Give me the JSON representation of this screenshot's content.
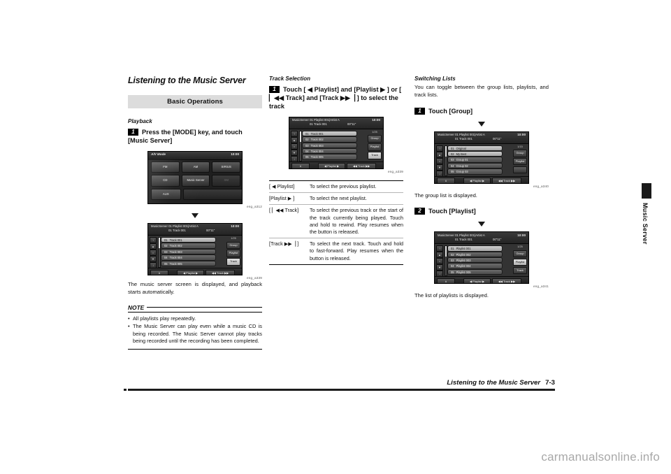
{
  "document": {
    "chapter_title": "Listening to the Music Server",
    "section_bar": "Basic Operations",
    "footer_title": "Listening to the Music Server",
    "footer_page": "7-3",
    "side_tab_label": "Music Server",
    "watermark": "carmanualsonline.info"
  },
  "left_column": {
    "sub_head": "Playback",
    "step1": {
      "number": "1",
      "text": "Press the [MODE] key, and touch [Music Server]"
    },
    "figure_av_mode": {
      "caption": "eng_a312",
      "title": "A/V Mode",
      "clock": "10:00",
      "buttons": [
        "FM",
        "AM",
        "SIRIUS",
        "CD",
        "Music Server",
        "XM",
        "AUX"
      ]
    },
    "figure_music_server": {
      "caption": "eng_a339",
      "header_line1": "MusicServer   01 Playlist 001|Artist A",
      "header_line2": "01 Track 001",
      "time": "00\"11\"",
      "clock": "10:00",
      "count": "1/25",
      "rail_buttons": [
        "↑",
        "▲",
        "○",
        "▼",
        "↓"
      ],
      "rows": [
        {
          "index": "01",
          "label": "Track 001",
          "selected": true
        },
        {
          "index": "02",
          "label": "Track 002",
          "selected": false
        },
        {
          "index": "03",
          "label": "Track 003",
          "selected": false
        },
        {
          "index": "04",
          "label": "Track 004",
          "selected": false
        },
        {
          "index": "05",
          "label": "Track 005",
          "selected": false
        }
      ],
      "right_buttons": [
        {
          "label": "Group",
          "active": false
        },
        {
          "label": "Playlist",
          "active": false
        },
        {
          "label": "Track",
          "active": true
        }
      ],
      "foot_buttons": [
        "∧",
        "◀ Playlist ▶",
        "◀◀ Track ▶▶"
      ]
    },
    "body_text": "The music server screen is displayed, and playback starts automatically.",
    "note": {
      "title": "NOTE",
      "items": [
        "All playlists play repeatedly.",
        "The Music Server can play even while a music CD is being recorded. The Music Server cannot play tracks being recorded until the recording has been completed."
      ]
    }
  },
  "middle_column": {
    "sub_head": "Track Selection",
    "step1": {
      "number": "1",
      "text_part1": "Touch [ ",
      "glyph1": "◀",
      "text_part2": " Playlist] and [Playlist ",
      "glyph2": "▶",
      "text_part3": " ] or [ ",
      "glyph3": "▏◀◀",
      "text_part4": " Track] and [Track ",
      "glyph4": "▶▶▕",
      "text_part5": " ] to select the track",
      "full_text": "Touch [ ◀ Playlist] and [Playlist ▶ ] or [ ▏◀◀ Track] and [Track ▶▶▕ ] to select the track"
    },
    "figure_music_server": {
      "caption": "eng_a339",
      "header_line1": "MusicServer   01 Playlist 001|Artist A",
      "header_line2": "01 Track 001",
      "time": "00\"11\"",
      "clock": "10:00",
      "count": "1/25",
      "rail_buttons": [
        "↑",
        "▲",
        "○",
        "▼",
        "↓"
      ],
      "rows": [
        {
          "index": "01",
          "label": "Track 001",
          "selected": true
        },
        {
          "index": "02",
          "label": "Track 002",
          "selected": false
        },
        {
          "index": "03",
          "label": "Track 003",
          "selected": false
        },
        {
          "index": "04",
          "label": "Track 004",
          "selected": false
        },
        {
          "index": "05",
          "label": "Track 005",
          "selected": false
        }
      ],
      "right_buttons": [
        {
          "label": "Group",
          "active": false
        },
        {
          "label": "Playlist",
          "active": false
        },
        {
          "label": "Track",
          "active": true
        }
      ],
      "foot_buttons": [
        "∧",
        "◀ Playlist ▶",
        "◀◀ Track ▶▶"
      ]
    },
    "spec_table": [
      {
        "key": "[ ◀ Playlist]",
        "desc": "To select the previous playlist."
      },
      {
        "key": "[Playlist ▶ ]",
        "desc": "To select the next playlist."
      },
      {
        "key": "[ ▏◀◀ Track]",
        "desc": "To select the previous track or the start of the track currently being played. Touch and hold to rewind. Play resumes when the button is released."
      },
      {
        "key": "[Track ▶▶▕ ]",
        "desc": "To select the next track. Touch and hold to fast-forward. Play resumes when the button is released."
      }
    ]
  },
  "right_column": {
    "sub_head": "Switching Lists",
    "intro_text": "You can toggle between the group lists, playlists, and track lists.",
    "step1": {
      "number": "1",
      "text": "Touch [Group]"
    },
    "figure_group": {
      "caption": "eng_a340",
      "header_line1": "MusicServer   01 Playlist 001|Artist A",
      "header_line2": "01 Track 001",
      "time": "00\"11\"",
      "clock": "10:00",
      "count": "1/15",
      "rail_buttons": [
        "↑",
        "▲",
        "○",
        "▼",
        "↓"
      ],
      "rows": [
        {
          "index": "01",
          "label": "Original",
          "selected": true
        },
        {
          "index": "02",
          "label": "My Best",
          "selected": true
        },
        {
          "index": "03",
          "label": "Group 01",
          "selected": false
        },
        {
          "index": "04",
          "label": "Group 02",
          "selected": false
        },
        {
          "index": "05",
          "label": "Group 03",
          "selected": false
        }
      ],
      "right_buttons": [
        {
          "label": "Group",
          "active": false
        },
        {
          "label": "Playlist",
          "active": false
        },
        {
          "label": "",
          "active": false
        }
      ],
      "foot_buttons": [
        "∧",
        "◀ Playlist ▶",
        "◀◀ Track ▶▶"
      ]
    },
    "caption_group": "The group list is displayed.",
    "step2": {
      "number": "2",
      "text": "Touch [Playlist]"
    },
    "figure_playlist": {
      "caption": "eng_a341",
      "header_line1": "MusicServer   01 Playlist 001|Artist A",
      "header_line2": "01 Track 001",
      "time": "00\"11\"",
      "clock": "10:00",
      "count": "1/25",
      "rail_buttons": [
        "↑",
        "▲",
        "○",
        "▼",
        "↓"
      ],
      "rows": [
        {
          "index": "01",
          "label": "Playlist 001",
          "selected": true
        },
        {
          "index": "02",
          "label": "Playlist 002",
          "selected": false
        },
        {
          "index": "03",
          "label": "Playlist 003",
          "selected": false
        },
        {
          "index": "04",
          "label": "Playlist 004",
          "selected": false
        },
        {
          "index": "05",
          "label": "Playlist 005",
          "selected": false
        }
      ],
      "right_buttons": [
        {
          "label": "Group",
          "active": false
        },
        {
          "label": "Playlist",
          "active": true
        },
        {
          "label": "Track",
          "active": false
        }
      ],
      "foot_buttons": [
        "∧",
        "◀ Playlist ▶",
        "◀◀ Track ▶▶"
      ]
    },
    "caption_playlist": "The list of playlists is displayed."
  }
}
